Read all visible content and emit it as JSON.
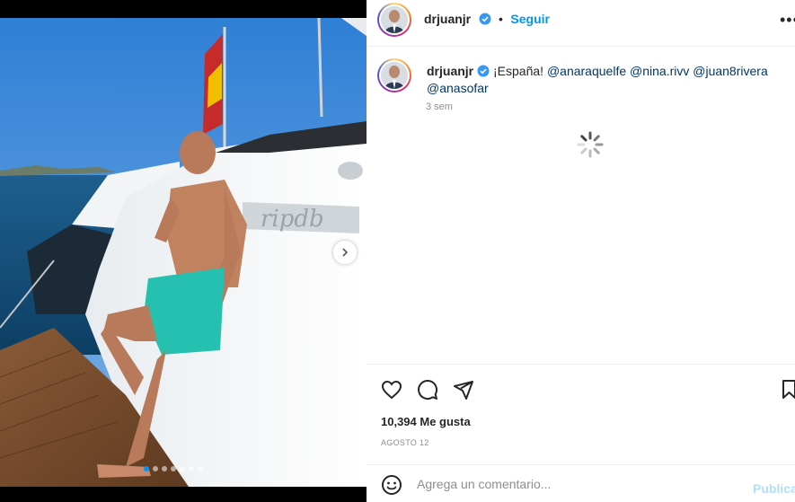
{
  "post": {
    "username": "drjuanjr",
    "follow_label": "Seguir",
    "more_label": "•••",
    "caption_text": "¡España!",
    "mentions": [
      "@anaraquelfe",
      "@nina.rivv",
      "@juan8rivera",
      "@anasofar"
    ],
    "time_ago": "3 sem",
    "likes_label": "10,394 Me gusta",
    "date_label": "AGOSTO 12",
    "carousel": {
      "total_slides": 7,
      "active_index": 0
    }
  },
  "comment": {
    "placeholder": "Agrega un comentario...",
    "publish_label": "Publica"
  },
  "icons": {
    "like": "heart-icon",
    "comment": "comment-icon",
    "share": "send-icon",
    "save": "bookmark-icon",
    "emoji": "emoji-icon",
    "verified": "verified-badge-icon",
    "next": "chevron-right-icon",
    "loading": "spinner-icon"
  },
  "colors": {
    "accent": "#0095f6",
    "verified": "#3897f0",
    "mention": "#00376b",
    "muted": "#8e8e8e",
    "publish_disabled": "#b2dffc"
  }
}
